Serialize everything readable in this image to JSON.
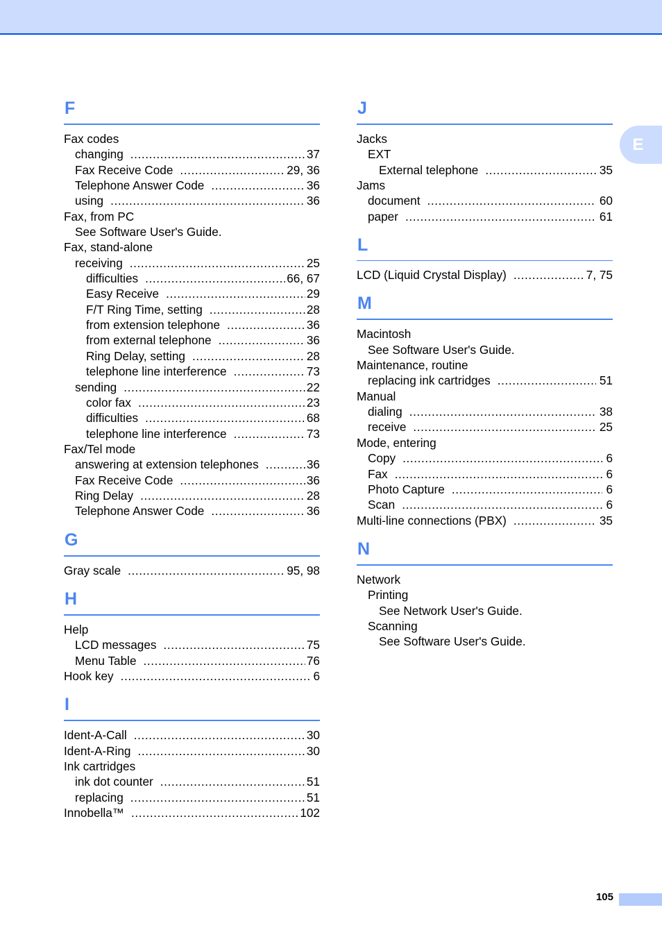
{
  "side_tab": {
    "label": "E"
  },
  "page_number": "105",
  "left_column": [
    {
      "letter": "F",
      "entries": [
        {
          "level": 1,
          "text": "Fax codes",
          "pages": ""
        },
        {
          "level": 2,
          "text": "changing",
          "pages": "37"
        },
        {
          "level": 2,
          "text": "Fax Receive Code",
          "pages": "29, 36"
        },
        {
          "level": 2,
          "text": "Telephone Answer Code",
          "pages": "36"
        },
        {
          "level": 2,
          "text": "using",
          "pages": "36"
        },
        {
          "level": 1,
          "text": "Fax, from PC",
          "pages": ""
        },
        {
          "level": 2,
          "text": "See Software User's Guide.",
          "pages": ""
        },
        {
          "level": 1,
          "text": "Fax, stand-alone",
          "pages": ""
        },
        {
          "level": 2,
          "text": "receiving",
          "pages": "25"
        },
        {
          "level": 3,
          "text": "difficulties",
          "pages": "66, 67"
        },
        {
          "level": 3,
          "text": "Easy Receive",
          "pages": "29"
        },
        {
          "level": 3,
          "text": "F/T Ring Time, setting",
          "pages": "28"
        },
        {
          "level": 3,
          "text": "from extension telephone",
          "pages": "36"
        },
        {
          "level": 3,
          "text": "from external telephone",
          "pages": "36"
        },
        {
          "level": 3,
          "text": "Ring Delay, setting",
          "pages": "28"
        },
        {
          "level": 3,
          "text": "telephone line interference",
          "pages": "73"
        },
        {
          "level": 2,
          "text": "sending",
          "pages": "22"
        },
        {
          "level": 3,
          "text": "color fax",
          "pages": "23"
        },
        {
          "level": 3,
          "text": "difficulties",
          "pages": "68"
        },
        {
          "level": 3,
          "text": "telephone line interference",
          "pages": "73"
        },
        {
          "level": 1,
          "text": "Fax/Tel mode",
          "pages": ""
        },
        {
          "level": 2,
          "text": "answering at extension telephones",
          "pages": "36"
        },
        {
          "level": 2,
          "text": "Fax Receive Code",
          "pages": "36"
        },
        {
          "level": 2,
          "text": "Ring Delay",
          "pages": "28"
        },
        {
          "level": 2,
          "text": "Telephone Answer Code",
          "pages": "36"
        }
      ]
    },
    {
      "letter": "G",
      "entries": [
        {
          "level": 1,
          "text": "Gray scale",
          "pages": "95, 98"
        }
      ]
    },
    {
      "letter": "H",
      "entries": [
        {
          "level": 1,
          "text": "Help",
          "pages": ""
        },
        {
          "level": 2,
          "text": "LCD messages",
          "pages": "75"
        },
        {
          "level": 2,
          "text": "Menu Table",
          "pages": "76"
        },
        {
          "level": 1,
          "text": "Hook key",
          "pages": "6"
        }
      ]
    },
    {
      "letter": "I",
      "entries": [
        {
          "level": 1,
          "text": "Ident-A-Call",
          "pages": "30"
        },
        {
          "level": 1,
          "text": "Ident-A-Ring",
          "pages": "30"
        },
        {
          "level": 1,
          "text": "Ink cartridges",
          "pages": ""
        },
        {
          "level": 2,
          "text": "ink dot counter",
          "pages": "51"
        },
        {
          "level": 2,
          "text": "replacing",
          "pages": "51"
        },
        {
          "level": 1,
          "text": "Innobella™",
          "pages": "102"
        }
      ]
    }
  ],
  "right_column": [
    {
      "letter": "J",
      "entries": [
        {
          "level": 1,
          "text": "Jacks",
          "pages": ""
        },
        {
          "level": 2,
          "text": "EXT",
          "pages": ""
        },
        {
          "level": 3,
          "text": "External telephone",
          "pages": "35"
        },
        {
          "level": 1,
          "text": "Jams",
          "pages": ""
        },
        {
          "level": 2,
          "text": "document",
          "pages": "60"
        },
        {
          "level": 2,
          "text": "paper",
          "pages": "61"
        }
      ]
    },
    {
      "letter": "L",
      "entries": [
        {
          "level": 1,
          "text": "LCD (Liquid Crystal Display)",
          "pages": "7, 75"
        }
      ]
    },
    {
      "letter": "M",
      "entries": [
        {
          "level": 1,
          "text": "Macintosh",
          "pages": ""
        },
        {
          "level": 2,
          "text": "See Software User's Guide.",
          "pages": ""
        },
        {
          "level": 1,
          "text": "Maintenance, routine",
          "pages": ""
        },
        {
          "level": 2,
          "text": "replacing ink cartridges",
          "pages": "51"
        },
        {
          "level": 1,
          "text": "Manual",
          "pages": ""
        },
        {
          "level": 2,
          "text": "dialing",
          "pages": "38"
        },
        {
          "level": 2,
          "text": "receive",
          "pages": "25"
        },
        {
          "level": 1,
          "text": "Mode, entering",
          "pages": ""
        },
        {
          "level": 2,
          "text": "Copy",
          "pages": "6"
        },
        {
          "level": 2,
          "text": "Fax",
          "pages": "6"
        },
        {
          "level": 2,
          "text": "Photo Capture",
          "pages": "6"
        },
        {
          "level": 2,
          "text": "Scan",
          "pages": "6"
        },
        {
          "level": 1,
          "text": "Multi-line connections (PBX)",
          "pages": "35"
        }
      ]
    },
    {
      "letter": "N",
      "entries": [
        {
          "level": 1,
          "text": "Network",
          "pages": ""
        },
        {
          "level": 2,
          "text": "Printing",
          "pages": ""
        },
        {
          "level": 3,
          "text": "See Network User's Guide.",
          "pages": ""
        },
        {
          "level": 2,
          "text": "Scanning",
          "pages": ""
        },
        {
          "level": 3,
          "text": "See Software User's Guide.",
          "pages": ""
        }
      ]
    }
  ]
}
